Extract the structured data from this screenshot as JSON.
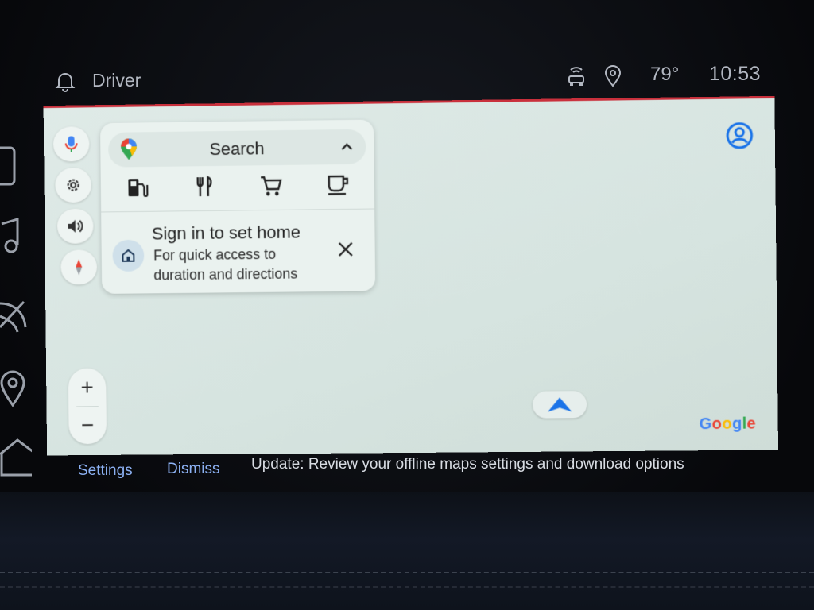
{
  "status_bar": {
    "profile": "Driver",
    "temperature": "79°",
    "time": "10:53"
  },
  "map": {
    "search": {
      "label": "Search",
      "categories": [
        "gas-station-icon",
        "restaurant-icon",
        "grocery-cart-icon",
        "coffee-icon"
      ]
    },
    "home_prompt": {
      "title": "Sign in to set home",
      "subtitle": "For quick access to duration and directions"
    },
    "zoom": {
      "in_label": "+",
      "out_label": "−"
    },
    "attribution_letters": [
      "G",
      "o",
      "o",
      "g",
      "l",
      "e"
    ]
  },
  "notice_bar": {
    "settings_label": "Settings",
    "dismiss_label": "Dismiss",
    "message": "Update: Review your offline maps settings and download options"
  },
  "colors": {
    "accent": "#8cb1f3",
    "nav_blue": "#1a73e8",
    "top_edge": "#c9303c"
  }
}
